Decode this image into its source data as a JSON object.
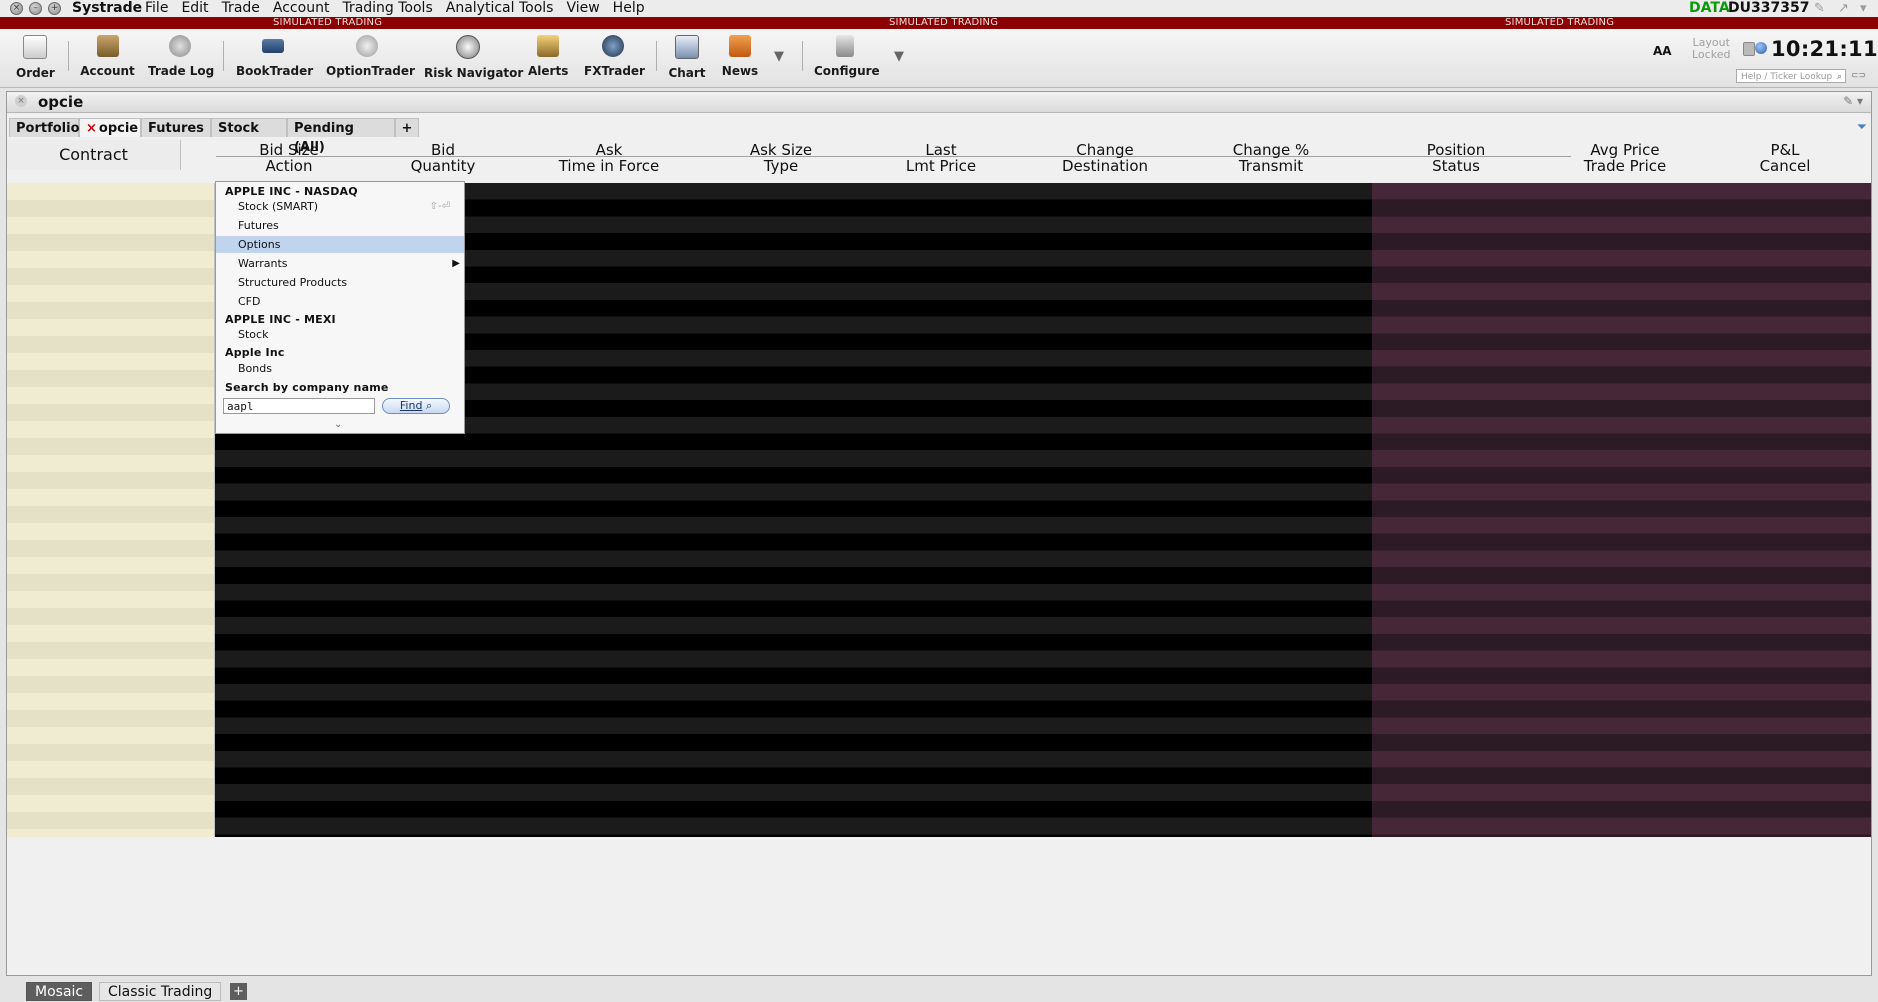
{
  "app": {
    "title": "Systrade",
    "menu": [
      "File",
      "Edit",
      "Trade",
      "Account",
      "Trading Tools",
      "Analytical Tools",
      "View",
      "Help"
    ],
    "data_label": "DATA",
    "account_id": "DU337357"
  },
  "banner": {
    "simulated": [
      "SIMULATED TRADING",
      "SIMULATED TRADING",
      "SIMULATED TRADING"
    ],
    "color": "#8b0000"
  },
  "toolbar": {
    "tools": [
      {
        "label": "Order",
        "icon": "order-icon"
      },
      {
        "label": "Account",
        "icon": "account-icon"
      },
      {
        "label": "Trade Log",
        "icon": "trade-log-icon"
      },
      {
        "label": "BookTrader",
        "icon": "booktrader-icon"
      },
      {
        "label": "OptionTrader",
        "icon": "optiontrader-icon"
      },
      {
        "label": "Risk Navigator",
        "icon": "risk-navigator-icon"
      },
      {
        "label": "Alerts",
        "icon": "alerts-icon"
      },
      {
        "label": "FXTrader",
        "icon": "fxtrader-icon"
      },
      {
        "label": "Chart",
        "icon": "chart-icon"
      },
      {
        "label": "News",
        "icon": "news-icon"
      },
      {
        "label": "Configure",
        "icon": "configure-icon"
      }
    ],
    "font_size_label": "AA",
    "layout_locked": [
      "Layout",
      "Locked"
    ],
    "clock": "10:21:11",
    "ticker_placeholder": "Help / Ticker Lookup"
  },
  "window": {
    "title": "opcie",
    "tabs": [
      "Portfolio",
      "opcie",
      "Futures",
      "Stock",
      "Pending (All)",
      "+"
    ],
    "active_tab": "opcie",
    "contract_header": "Contract",
    "columns": [
      {
        "top": "Bid Size",
        "bottom": "Action"
      },
      {
        "top": "Bid",
        "bottom": "Quantity"
      },
      {
        "top": "Ask",
        "bottom": "Time in Force"
      },
      {
        "top": "Ask Size",
        "bottom": "Type"
      },
      {
        "top": "Last",
        "bottom": "Lmt Price"
      },
      {
        "top": "Change",
        "bottom": "Destination"
      },
      {
        "top": "Change %",
        "bottom": "Transmit"
      },
      {
        "top": "Position",
        "bottom": "Status"
      },
      {
        "top": "Avg Price",
        "bottom": "Trade Price"
      },
      {
        "top": "P&L",
        "bottom": "Cancel"
      }
    ]
  },
  "dropdown": {
    "groups": [
      {
        "title": "APPLE INC - NASDAQ",
        "items": [
          "Stock (SMART)",
          "Futures",
          "Options",
          "Warrants",
          "Structured Products",
          "CFD"
        ]
      },
      {
        "title": "APPLE INC - MEXI",
        "items": [
          "Stock"
        ]
      },
      {
        "title": "Apple Inc",
        "items": [
          "Bonds"
        ]
      }
    ],
    "selected_item": "Options",
    "shortcut_hint": "⇧-⏎",
    "search_label": "Search by company name",
    "search_value": "aapl",
    "find_label": "Find"
  },
  "bottom_tabs": {
    "items": [
      "Mosaic",
      "Classic Trading"
    ],
    "active": "Mosaic",
    "add": "+"
  }
}
